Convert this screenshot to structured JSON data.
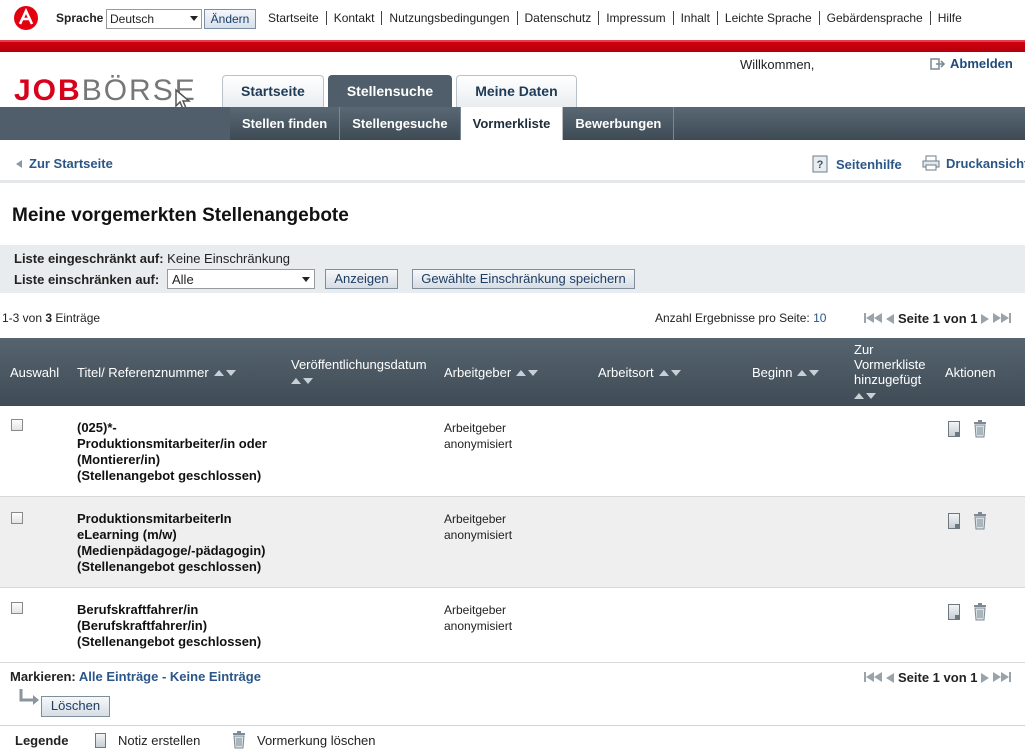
{
  "topbar": {
    "language_label": "Sprache",
    "language_value": "Deutsch",
    "change_button": "Ändern",
    "links": [
      "Startseite",
      "Kontakt",
      "Nutzungsbedingungen",
      "Datenschutz",
      "Impressum",
      "Inhalt",
      "Leichte Sprache",
      "Gebärdensprache",
      "Hilfe"
    ]
  },
  "header": {
    "brand_a": "JOB",
    "brand_b": "BÖRSE",
    "welcome": "Willkommen,",
    "logout": "Abmelden",
    "main_tabs": [
      "Startseite",
      "Stellensuche",
      "Meine Daten"
    ],
    "sub_tabs": [
      "Stellen finden",
      "Stellengesuche",
      "Vormerkliste",
      "Bewerbungen"
    ]
  },
  "crumbs": {
    "back": "Zur Startseite",
    "help": "Seitenhilfe",
    "print": "Druckansicht"
  },
  "page_title": "Meine vorgemerkten Stellenangebote",
  "filter": {
    "restricted_label": "Liste eingeschränkt auf:",
    "restricted_value": "Keine Einschränkung",
    "restrict_label": "Liste einschränken auf:",
    "restrict_value": "Alle",
    "show_button": "Anzeigen",
    "save_button": "Gewählte Einschränkung speichern"
  },
  "results": {
    "count_prefix": "1-3 von ",
    "count_total": "3",
    "count_suffix": " Einträge",
    "per_page_label": "Anzahl Ergebnisse pro Seite:",
    "per_page_value": "10",
    "page_label": "Seite 1 von 1"
  },
  "table": {
    "columns": [
      "Auswahl",
      "Titel/ Referenznummer",
      "Veröffentlichungsdatum",
      "Arbeitgeber",
      "Arbeitsort",
      "Beginn",
      "Zur\nVormerkliste\nhinzugefügt",
      "Aktionen"
    ],
    "rows": [
      {
        "title": "(025)*-\nProduktionsmitarbeiter/in oder\n(Montierer/in)\n(Stellenangebot geschlossen)",
        "employer": "Arbeitgeber\nanonymisiert"
      },
      {
        "title": "ProduktionsmitarbeiterIn\neLearning (m/w)\n(Medienpädagoge/-pädagogin)\n(Stellenangebot geschlossen)",
        "employer": "Arbeitgeber\nanonymisiert"
      },
      {
        "title": "Berufskraftfahrer/in\n(Berufskraftfahrer/in)\n(Stellenangebot geschlossen)",
        "employer": "Arbeitgeber\nanonymisiert"
      }
    ]
  },
  "footer": {
    "mark_label": "Markieren:",
    "mark_all": "Alle Einträge",
    "mark_sep": " - ",
    "mark_none": "Keine Einträge",
    "delete_button": "Löschen",
    "legend_title": "Legende",
    "legend_note": "Notiz erstellen",
    "legend_delete": "Vormerkung löschen"
  },
  "colors": {
    "brand_red": "#d8001a",
    "nav_dark": "#4f5e6a",
    "link_blue": "#2b5688"
  },
  "icons": [
    "agency-logo-icon",
    "cursor-icon",
    "logout-icon",
    "back-arrow-icon",
    "help-icon",
    "print-icon",
    "sort-icon",
    "note-icon",
    "trash-icon",
    "return-arrow-icon",
    "first-page-icon",
    "prev-page-icon",
    "next-page-icon",
    "last-page-icon"
  ]
}
